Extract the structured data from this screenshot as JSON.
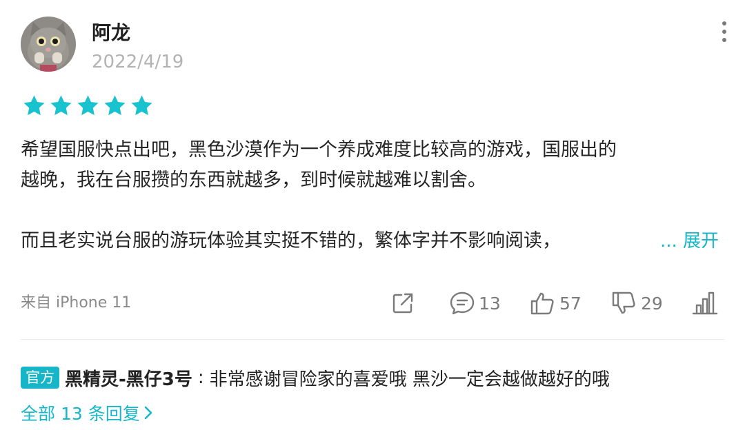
{
  "user": {
    "name": "阿龙",
    "date": "2022/4/19"
  },
  "rating": {
    "stars": 5,
    "max": 5,
    "color": "#19c2cf"
  },
  "review": {
    "line1": "希望国服快点出吧，黑色沙漠作为一个养成难度比较高的游戏，国服出的",
    "line2": "越晚，我在台服攒的东西就越多，到时候就越难以割舍。",
    "line3": "而且老实说台服的游玩体验其实挺不错的，繁体字并不影响阅读，",
    "expand_label": "... 展开"
  },
  "footer": {
    "device": "来自 iPhone 11",
    "comments_count": "13",
    "likes_count": "57",
    "dislikes_count": "29"
  },
  "reply": {
    "badge": "官方",
    "author": "黑精灵-黑仔3号",
    "separator": ":",
    "text": "非常感谢冒险家的喜爱哦 黑沙一定会越做越好的哦",
    "all_replies_label": "全部 13 条回复"
  },
  "colors": {
    "accent": "#14b6c8",
    "icon_gray": "#7a7a7a"
  },
  "icons": [
    "more-vertical-icon",
    "star-icon",
    "share-icon",
    "comment-icon",
    "thumbs-up-icon",
    "thumbs-down-icon",
    "stats-icon",
    "chevron-right-icon"
  ]
}
